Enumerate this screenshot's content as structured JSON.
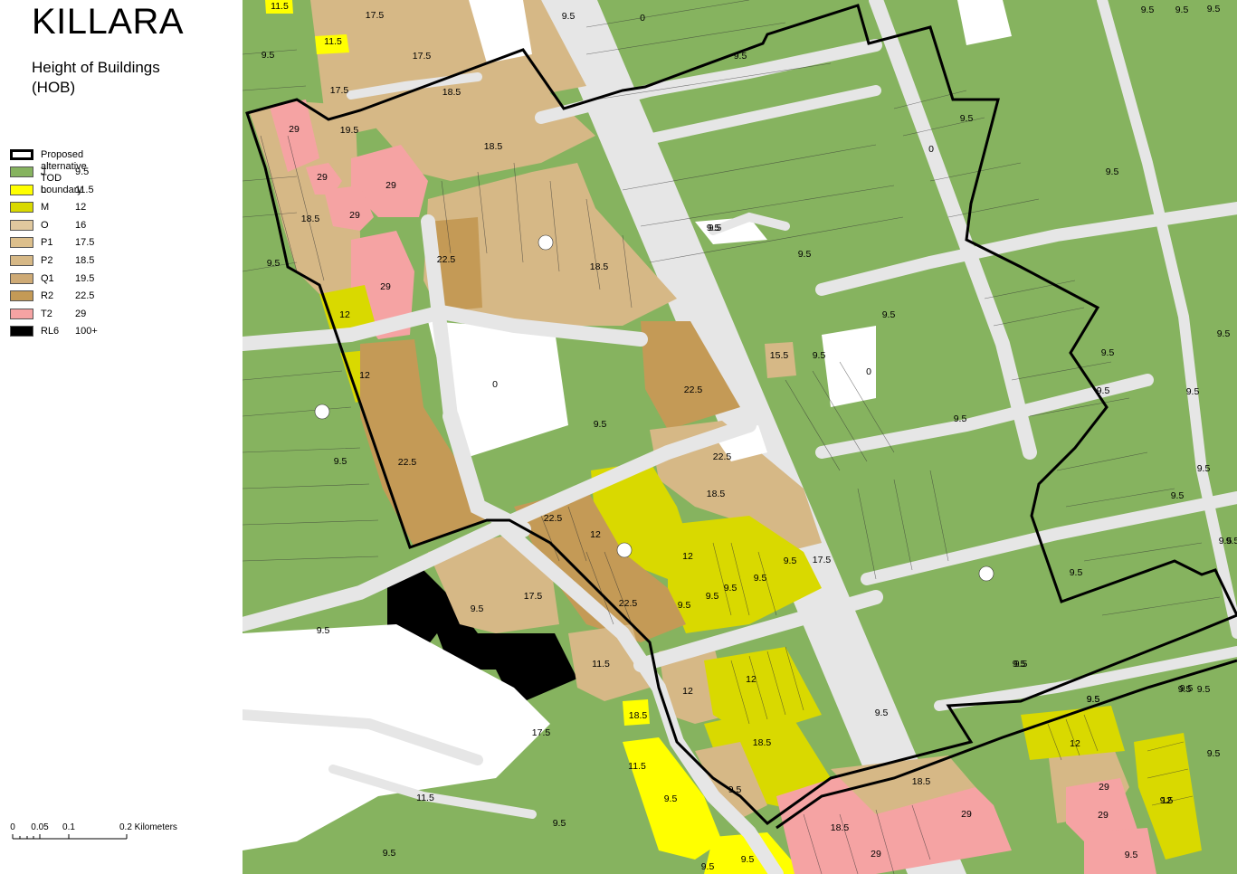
{
  "title": "KILLARA",
  "subtitle_line1": "Height of Buildings",
  "subtitle_line2": "(HOB)",
  "legend": {
    "boundary_label": "Proposed alternative TOD boundary",
    "items": [
      {
        "code": "J",
        "value": "9.5",
        "color": "#86b35f"
      },
      {
        "code": "L",
        "value": "11.5",
        "color": "#ffff00"
      },
      {
        "code": "M",
        "value": "12",
        "color": "#d9d900"
      },
      {
        "code": "O",
        "value": "16",
        "color": "#e0c89e"
      },
      {
        "code": "P1",
        "value": "17.5",
        "color": "#dcbf8c"
      },
      {
        "code": "P2",
        "value": "18.5",
        "color": "#d6b886"
      },
      {
        "code": "Q1",
        "value": "19.5",
        "color": "#ceaa75"
      },
      {
        "code": "R2",
        "value": "22.5",
        "color": "#c49a56"
      },
      {
        "code": "T2",
        "value": "29",
        "color": "#f5a3a3"
      },
      {
        "code": "RL6",
        "value": "100+",
        "color": "#000000"
      }
    ]
  },
  "scale": {
    "ticks": [
      "0",
      "0.05",
      "0.1",
      "0.2 Kilometers"
    ]
  },
  "colors": {
    "road": "#e6e6e6",
    "boundary": "#000000",
    "open_land": "#ffffff"
  },
  "map_labels": [
    "11.5",
    "17.5",
    "11.5",
    "17.5",
    "9.5",
    "17.5",
    "18.5",
    "19.5",
    "29",
    "18.5",
    "29",
    "29",
    "29",
    "18.5",
    "9.5",
    "29",
    "12",
    "12",
    "22.5",
    "18.5",
    "0",
    "22.5",
    "22.5",
    "9.5",
    "9.5",
    "22.5",
    "18.5",
    "22.5",
    "12",
    "12",
    "22.5",
    "9.5",
    "9.5",
    "9.5",
    "9.5",
    "9.5",
    "17.5",
    "9.5",
    "17.5",
    "11.5",
    "18.5",
    "12",
    "12",
    "18.5",
    "9.5",
    "9.5",
    "9.5",
    "17.5",
    "11.5",
    "9.5",
    "11.5",
    "9.5",
    "18.5",
    "29",
    "29",
    "18.5",
    "29",
    "12",
    "29",
    "9.5",
    "9.5",
    "9.5",
    "9.5",
    "9.5",
    "0",
    "9.5",
    "9.5",
    "15.5",
    "9.5",
    "0",
    "9.5",
    "9.5",
    "9.5",
    "9.5",
    "9.5",
    "9.5",
    "9.5",
    "9.5",
    "9.5",
    "9.5",
    "9.5",
    "9.5",
    "9.5",
    "9.5",
    "9.5",
    "9.5",
    "9.5",
    "9.5",
    "0",
    "9.5",
    "9.5",
    "9.5",
    "9.5",
    "9.5",
    "9.5",
    "9.5",
    "9.5",
    "9.5",
    "12"
  ]
}
